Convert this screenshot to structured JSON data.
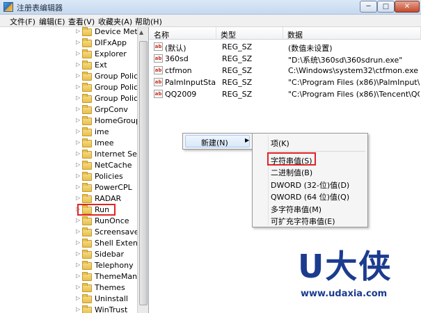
{
  "window": {
    "title": "注册表编辑器",
    "min": "─",
    "max": "□",
    "close": "✕"
  },
  "menu": [
    "文件(F)",
    "编辑(E)",
    "查看(V)",
    "收藏夹(A)",
    "帮助(H)"
  ],
  "tree": {
    "items": [
      "Device Metac",
      "DIFxApp",
      "Explorer",
      "Ext",
      "Group Policy",
      "Group Policy",
      "Group Policy",
      "GrpConv",
      "HomeGroup",
      "ime",
      "Imee",
      "Internet Settir",
      "NetCache",
      "Policies",
      "PowerCPL",
      "RADAR",
      "Run",
      "RunOnce",
      "Screensavers",
      "Shell Extensic",
      "Sidebar",
      "Telephony",
      "ThemeManag",
      "Themes",
      "Uninstall",
      "WinTrust"
    ],
    "selected": "Run"
  },
  "list": {
    "headers": {
      "name": "名称",
      "type": "类型",
      "data": "数据"
    },
    "rows": [
      {
        "name": "(默认)",
        "type": "REG_SZ",
        "data": "(数值未设置)"
      },
      {
        "name": "360sd",
        "type": "REG_SZ",
        "data": "\"D:\\系统\\360sd\\360sdrun.exe\""
      },
      {
        "name": "ctfmon",
        "type": "REG_SZ",
        "data": "C:\\Windows\\system32\\ctfmon.exe"
      },
      {
        "name": "PalmInputStart...",
        "type": "REG_SZ",
        "data": "\"C:\\Program Files (x86)\\PalmInput\\2.3.0"
      },
      {
        "name": "QQ2009",
        "type": "REG_SZ",
        "data": "\"C:\\Program Files (x86)\\Tencent\\QQ\\Bi"
      }
    ]
  },
  "context_menu": {
    "new_label": "新建(N)",
    "new_arrow": "▶",
    "submenu": {
      "key": "项(K)",
      "items": [
        "字符串值(S)",
        "二进制值(B)",
        "DWORD (32-位)值(D)",
        "QWORD (64 位)值(Q)",
        "多字符串值(M)",
        "可扩充字符串值(E)"
      ],
      "highlighted": "字符串值(S)"
    }
  },
  "watermark": {
    "logo": "U大侠",
    "url": "www.udaxia.com"
  },
  "icons": {
    "value_icon": "ab",
    "tree_arrow": "▷",
    "scroll_up": "▲"
  }
}
